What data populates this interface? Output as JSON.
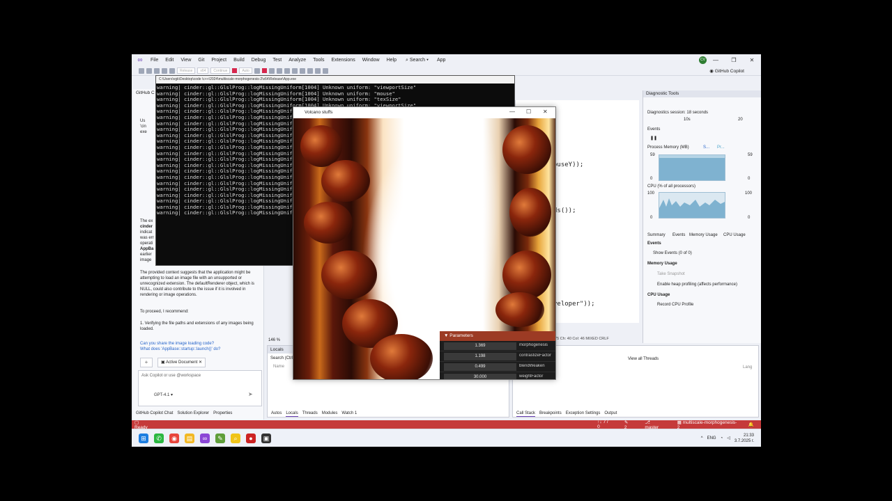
{
  "menubar": {
    "items": [
      "File",
      "Edit",
      "View",
      "Git",
      "Project",
      "Build",
      "Debug",
      "Test",
      "Analyze",
      "Tools",
      "Extensions",
      "Window",
      "Help"
    ],
    "search_label": "Search",
    "app_label": "App",
    "avatar_initials": "CV"
  },
  "toolbar": {
    "config": "Release",
    "platform": "x64",
    "continue_label": "Continue",
    "auto_label": "Auto",
    "copilot_label": "GitHub Copilot"
  },
  "copilot": {
    "title": "GitHub C",
    "frag_a": "Us",
    "frag_b": "'cin",
    "frag_c": "exe",
    "para1_l1": "The ex",
    "para1_l2": "cinder",
    "para1_l3": "indicat",
    "para1_l4": "was err",
    "para1_l5": "operati",
    "para1_l6": "AppBa",
    "para1_l7": "earlier",
    "para1_l8": "image",
    "para2": "The provided context suggests that the application might be attempting to load an image file with an unsupported or unrecognized extension. The defaultRenderer object, which is NULL, could also contribute to the issue if it is involved in rendering or image operations.",
    "para3": "To proceed, I recommend:",
    "para4": "1.  Verifying the file paths and extensions of any images being loaded.",
    "q1": "Can you share the image loading code?",
    "q2": "What does 'AppBase::startup::launch()' do?",
    "doc_label": "Active Document",
    "ask_placeholder": "Ask Copilot or use @workspace",
    "model": "GPT-4.1",
    "tabs": [
      "GitHub Copilot Chat",
      "Solution Explorer",
      "Properties"
    ]
  },
  "console": {
    "title": "C:\\Users\\vgk\\Desktop\\code \\c++\\2024\\multiscale-morphogenesis-2\\x64\\Release\\App.exe",
    "lines": [
      "warning| cinder::gl::GlslProg::logMissingUniform[1004] Unknown uniform: \"viewportSize\"",
      "warning| cinder::gl::GlslProg::logMissingUniform[1004] Unknown uniform: \"mouse\"",
      "warning| cinder::gl::GlslProg::logMissingUniform[1004] Unknown uniform: \"texSize\"",
      "warning| cinder::gl::GlslProg::logMissingUniform[1004] Unknown uniform: \"viewportSize\"",
      "warning| cinder::gl::GlslProg::logMissingUnifo",
      "warning| cinder::gl::GlslProg::logMissingUnifo",
      "warning| cinder::gl::GlslProg::logMissingUnifo",
      "warning| cinder::gl::GlslProg::logMissingUnifo",
      "warning| cinder::gl::GlslProg::logMissingUnifo",
      "warning| cinder::gl::GlslProg::logMissingUnifo",
      "warning| cinder::gl::GlslProg::logMissingUnifo",
      "warning| cinder::gl::GlslProg::logMissingUnifo",
      "warning| cinder::gl::GlslProg::logMissingUnifo",
      "warning| cinder::gl::GlslProg::logMissingUnifo",
      "warning| cinder::gl::GlslProg::logMissingUnifo",
      "warning| cinder::gl::GlslProg::logMissingUnifo",
      "warning| cinder::gl::GlslProg::logMissingUnifo",
      "warning| cinder::gl::GlslProg::logMissingUnifo",
      "warning| cinder::gl::GlslProg::logMissingUnifo",
      "warning| cinder::gl::GlslProg::logMissingUnifo",
      "warning| cinder::gl::GlslProg::logMissingUnifo",
      "warning| cinder::gl::GlslProg::logMissingUnifo"
    ]
  },
  "editor": {
    "code1": "ouseY));",
    "code2": "ds());",
    "code3": "veloper\"));",
    "status": "575   Ch: 40   Col: 46   MIXED   CRLF"
  },
  "diagnostic": {
    "title": "Diagnostic Tools",
    "session": "Diagnostics session: 18 seconds",
    "t1": "10s",
    "t2": "20",
    "events": "Events",
    "mem": "Process Memory (MB)",
    "mem_legend": "S...",
    "mem_legend2": "Pr...",
    "mem_max": "59",
    "mem_min": "0",
    "cpu": "CPU (% of all processors)",
    "cpu_max": "100",
    "cpu_min": "0",
    "tabs": [
      "Summary",
      "Events",
      "Memory Usage",
      "CPU Usage"
    ],
    "events_head": "Events",
    "show_events": "Show Events (0 of 0)",
    "mem_usage": "Memory Usage",
    "snapshot": "Take Snapshot",
    "heap": "Enable heap profiling (affects performance)",
    "cpu_usage": "CPU Usage",
    "record": "Record CPU Profile"
  },
  "locals": {
    "title": "Locals",
    "search": "Search (Ctrl",
    "col": "Name",
    "zoom": "146 %",
    "tabs": [
      "Autos",
      "Locals",
      "Threads",
      "Modules",
      "Watch 1"
    ]
  },
  "callstack": {
    "threads": "View all Threads",
    "lang": "Lang",
    "tabs": [
      "Call Stack",
      "Breakpoints",
      "Exception Settings",
      "Output"
    ]
  },
  "statusbar": {
    "ready": "Ready",
    "nav": "7 / 0",
    "edits": "2",
    "branch": "master",
    "repo": "multiscale-morphogenesis-2"
  },
  "volcano": {
    "title": "Volcano stuffs",
    "params_title": "Parameters",
    "params": [
      {
        "value": "1.369",
        "name": "morphogenesis"
      },
      {
        "value": "1.198",
        "name": "contrastizeFactor"
      },
      {
        "value": "0.499",
        "name": "blendWeaken"
      },
      {
        "value": "30.000",
        "name": "weightFactor"
      }
    ]
  },
  "taskbar": {
    "lang": "ENG",
    "time": "21:33",
    "date": "3.7.2025 г."
  },
  "colors": {
    "statusbar": "#c53a3a",
    "params_header": "#9c3b24",
    "vs_purple": "#6a3fb5"
  }
}
